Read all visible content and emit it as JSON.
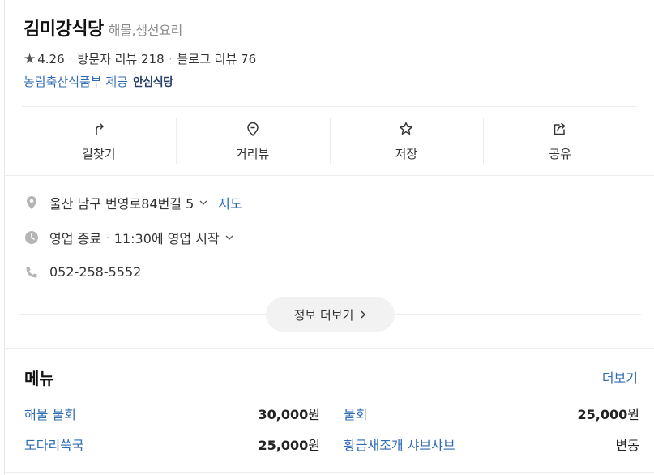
{
  "place": {
    "name": "김미강식당",
    "category": "해물,생선요리",
    "rating": "4.26",
    "visitor_reviews": "방문자 리뷰 218",
    "blog_reviews": "블로그 리뷰 76",
    "provider": "농림축산식품부 제공",
    "badge": "안심식당"
  },
  "actions": [
    {
      "label": "길찾기",
      "icon": "directions-icon"
    },
    {
      "label": "거리뷰",
      "icon": "street-view-icon"
    },
    {
      "label": "저장",
      "icon": "star-outline-icon"
    },
    {
      "label": "공유",
      "icon": "share-icon"
    }
  ],
  "info": {
    "address": "울산 남구 번영로84번길 5",
    "map_link": "지도",
    "status": "영업 종료",
    "hours_note": "11:30에 영업 시작",
    "phone": "052-258-5552",
    "more_button": "정보 더보기"
  },
  "menu": {
    "title": "메뉴",
    "more": "더보기",
    "items": [
      {
        "name": "해물 물회",
        "price": "30,000",
        "unit": "원"
      },
      {
        "name": "물회",
        "price": "25,000",
        "unit": "원"
      },
      {
        "name": "도다리쑥국",
        "price": "25,000",
        "unit": "원"
      },
      {
        "name": "황금새조개 샤브샤브",
        "price": "변동",
        "unit": ""
      }
    ]
  },
  "colors": {
    "link": "#2f6bb3",
    "badge": "#2a3f6b",
    "icon_gray": "#b5b5b5"
  }
}
